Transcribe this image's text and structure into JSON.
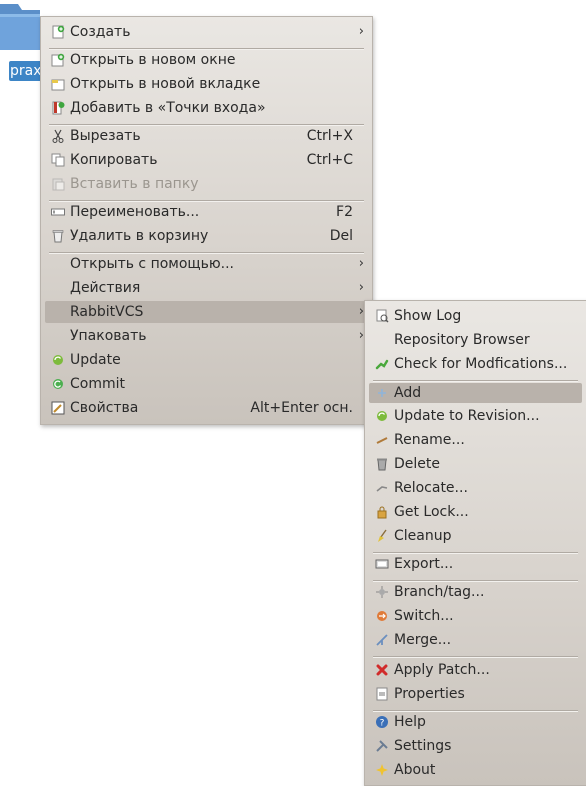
{
  "desktop": {
    "folder_label": "prax"
  },
  "main_menu": {
    "items": [
      {
        "label": "Создать",
        "shortcut": "",
        "submenu": true,
        "icon": "new-document-icon"
      },
      {
        "label": "Открыть в новом окне",
        "shortcut": "",
        "submenu": false,
        "icon": "new-window-icon"
      },
      {
        "label": "Открыть в новой вкладке",
        "shortcut": "",
        "submenu": false,
        "icon": "new-tab-icon"
      },
      {
        "label": "Добавить в «Точки входа»",
        "shortcut": "",
        "submenu": false,
        "icon": "bookmark-add-icon"
      },
      {
        "label": "Вырезать",
        "shortcut": "Ctrl+X",
        "submenu": false,
        "icon": "cut-icon"
      },
      {
        "label": "Копировать",
        "shortcut": "Ctrl+C",
        "submenu": false,
        "icon": "copy-icon"
      },
      {
        "label": "Вставить в папку",
        "shortcut": "",
        "submenu": false,
        "icon": "paste-icon",
        "disabled": true
      },
      {
        "label": "Переименовать...",
        "shortcut": "F2",
        "submenu": false,
        "icon": "rename-icon"
      },
      {
        "label": "Удалить в корзину",
        "shortcut": "Del",
        "submenu": false,
        "icon": "trash-icon"
      },
      {
        "label": "Открыть с помощью...",
        "shortcut": "",
        "submenu": true,
        "icon": ""
      },
      {
        "label": "Действия",
        "shortcut": "",
        "submenu": true,
        "icon": ""
      },
      {
        "label": "RabbitVCS",
        "shortcut": "",
        "submenu": true,
        "icon": "",
        "selected": true
      },
      {
        "label": "Упаковать",
        "shortcut": "",
        "submenu": true,
        "icon": ""
      },
      {
        "label": "Update",
        "shortcut": "",
        "submenu": false,
        "icon": "update-icon"
      },
      {
        "label": "Commit",
        "shortcut": "",
        "submenu": false,
        "icon": "commit-icon"
      },
      {
        "label": "Свойства",
        "shortcut": "Alt+Enter осн.",
        "submenu": false,
        "icon": "properties-icon"
      }
    ]
  },
  "rabbitvcs_menu": {
    "items": [
      {
        "label": "Show Log",
        "icon": "show-log-icon"
      },
      {
        "label": "Repository Browser",
        "icon": ""
      },
      {
        "label": "Check for Modfications...",
        "icon": "check-modifications-icon"
      },
      {
        "label": "Add",
        "icon": "add-icon",
        "selected": true
      },
      {
        "label": "Update to Revision...",
        "icon": "update-revision-icon"
      },
      {
        "label": "Rename...",
        "icon": "rename-pencil-icon"
      },
      {
        "label": "Delete",
        "icon": "delete-icon"
      },
      {
        "label": "Relocate...",
        "icon": "relocate-icon"
      },
      {
        "label": "Get Lock...",
        "icon": "lock-icon"
      },
      {
        "label": "Cleanup",
        "icon": "cleanup-icon"
      },
      {
        "label": "Export...",
        "icon": "export-icon"
      },
      {
        "label": "Branch/tag...",
        "icon": "branch-icon"
      },
      {
        "label": "Switch...",
        "icon": "switch-icon"
      },
      {
        "label": "Merge...",
        "icon": "merge-icon"
      },
      {
        "label": "Apply Patch...",
        "icon": "apply-patch-icon"
      },
      {
        "label": "Properties",
        "icon": "properties-doc-icon"
      },
      {
        "label": "Help",
        "icon": "help-icon"
      },
      {
        "label": "Settings",
        "icon": "settings-icon"
      },
      {
        "label": "About",
        "icon": "about-icon"
      }
    ]
  },
  "colors": {
    "selection_label_bg": "#3d85c6",
    "menu_bg_top": "#eae7e3",
    "menu_bg_bottom": "#c9c3bc",
    "highlight": "#b9b2ab",
    "disabled_text": "#9b968f"
  }
}
